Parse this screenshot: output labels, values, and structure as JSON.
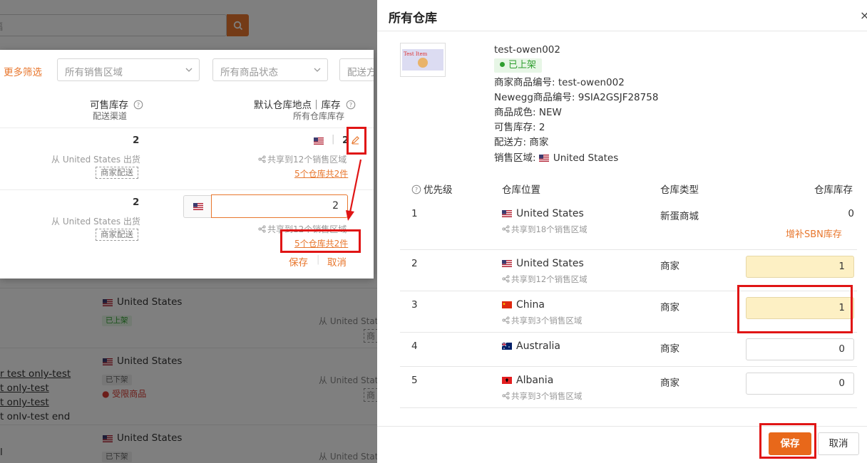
{
  "colors": {
    "accent": "#e8772e",
    "save": "#e8681a",
    "annotation": "#e01515",
    "active_green": "#2f9e2f",
    "warn_input": "#fdf0c4"
  },
  "background": {
    "search_placeholder": "福",
    "rows": [
      {
        "country": "United States",
        "status": "已上架",
        "ship": "从 United Stat",
        "badge": "商"
      },
      {
        "country": "United States",
        "status": "已下架",
        "restricted": "受限商品",
        "links": [
          "r test only-test",
          "t only-test",
          "t only-test",
          "t onlv-test end"
        ],
        "ship": "从 United Stat",
        "badge": "商"
      },
      {
        "country": "United States",
        "status": "已下架",
        "ship": "从 United Stat",
        "left_char": "l"
      }
    ]
  },
  "popover": {
    "more_filters": "更多筛选",
    "filters": [
      "所有销售区域",
      "所有商品状态",
      "配送方"
    ],
    "col_stock": {
      "title": "可售库存",
      "sub": "配送渠道"
    },
    "col_wh": {
      "title": "默认仓库地点｜库存",
      "sub": "所有仓库库存"
    },
    "rows": [
      {
        "stock": "2",
        "ship": "从 United States 出货",
        "badge": "商家配送",
        "wh_stock": "2",
        "share": "共享到12个销售区域",
        "wh_link": "5个仓库共2件"
      },
      {
        "stock": "2",
        "ship": "从 United States 出货",
        "badge": "商家配送",
        "input_value": "2",
        "share": "共享到12个销售区域",
        "wh_link": "5个仓库共2件",
        "save": "保存",
        "cancel": "取消"
      }
    ]
  },
  "drawer": {
    "title": "所有仓库",
    "close": "×",
    "product": {
      "image_text": "Test Item",
      "name": "test-owen002",
      "status": "已上架",
      "seller_sku": "商家商品编号: test-owen002",
      "newegg_sku": "Newegg商品编号: 9SIA2GSJF28758",
      "condition": "商品成色: NEW",
      "available": "可售库存: 2",
      "ship_by": "配送方: 商家",
      "region_label": "销售区域:",
      "region": "United States"
    },
    "table": {
      "headers": {
        "priority": "优先级",
        "location": "仓库位置",
        "type": "仓库类型",
        "stock": "仓库库存"
      },
      "rows": [
        {
          "priority": "1",
          "country": "United States",
          "flag": "us",
          "share": "共享到18个销售区域",
          "type": "新蛋商城",
          "stock": "0",
          "action": "增补SBN库存"
        },
        {
          "priority": "2",
          "country": "United States",
          "flag": "us",
          "share": "共享到12个销售区域",
          "type": "商家",
          "stock": "1"
        },
        {
          "priority": "3",
          "country": "China",
          "flag": "cn",
          "share": "共享到3个销售区域",
          "type": "商家",
          "stock": "1"
        },
        {
          "priority": "4",
          "country": "Australia",
          "flag": "au",
          "type": "商家",
          "stock": "0"
        },
        {
          "priority": "5",
          "country": "Albania",
          "flag": "al",
          "share": "共享到3个销售区域",
          "type": "商家",
          "stock": "0"
        }
      ]
    },
    "save": "保存",
    "cancel": "取消"
  }
}
